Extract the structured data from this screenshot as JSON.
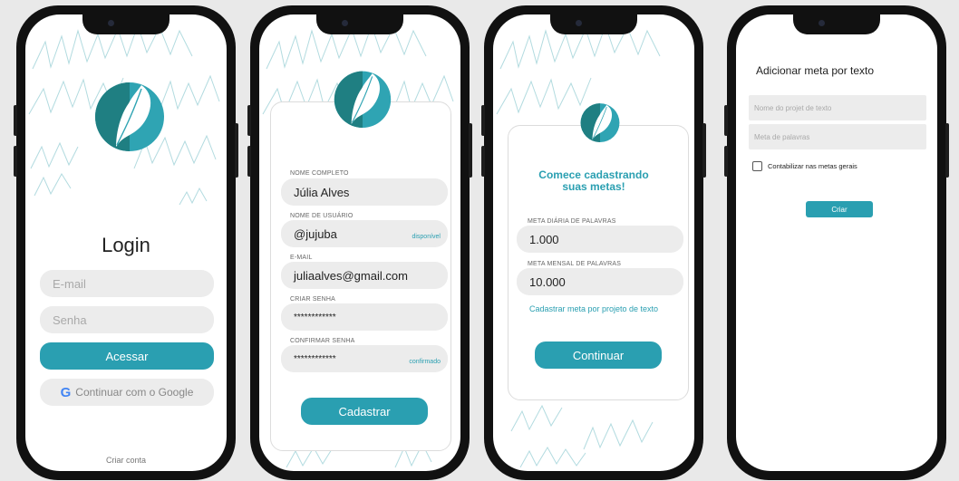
{
  "colors": {
    "accent": "#2a9fb1",
    "field_bg": "#ececec",
    "logo_dark": "#1f7f82",
    "logo_light": "#2fa4b3"
  },
  "login": {
    "title": "Login",
    "email_placeholder": "E-mail",
    "password_placeholder": "Senha",
    "submit_label": "Acessar",
    "google_label": "Continuar com o Google",
    "create_account_link": "Criar conta"
  },
  "signup": {
    "fields": [
      {
        "label": "NOME COMPLETO",
        "value": "Júlia Alves",
        "tag": ""
      },
      {
        "label": "NOME DE USUÁRIO",
        "value": "@jujuba",
        "tag": "disponível"
      },
      {
        "label": "E-MAIL",
        "value": "juliaalves@gmail.com",
        "tag": ""
      },
      {
        "label": "CRIAR SENHA",
        "value": "************",
        "tag": ""
      },
      {
        "label": "CONFIRMAR SENHA",
        "value": "************",
        "tag": "confirmado"
      }
    ],
    "submit_label": "Cadastrar"
  },
  "goals": {
    "heading_line1": "Comece cadastrando",
    "heading_line2": "suas metas!",
    "daily_label": "META DIÁRIA DE PALAVRAS",
    "daily_value": "1.000",
    "monthly_label": "META MENSAL DE PALAVRAS",
    "monthly_value": "10.000",
    "project_link": "Cadastrar meta por projeto de texto",
    "continue_label": "Continuar"
  },
  "text_goal": {
    "title": "Adicionar meta por texto",
    "project_placeholder": "Nome do projet de texto",
    "words_placeholder": "Meta de palavras",
    "checkbox_label": "Contabilizar nas metas gerais",
    "submit_label": "Criar"
  }
}
